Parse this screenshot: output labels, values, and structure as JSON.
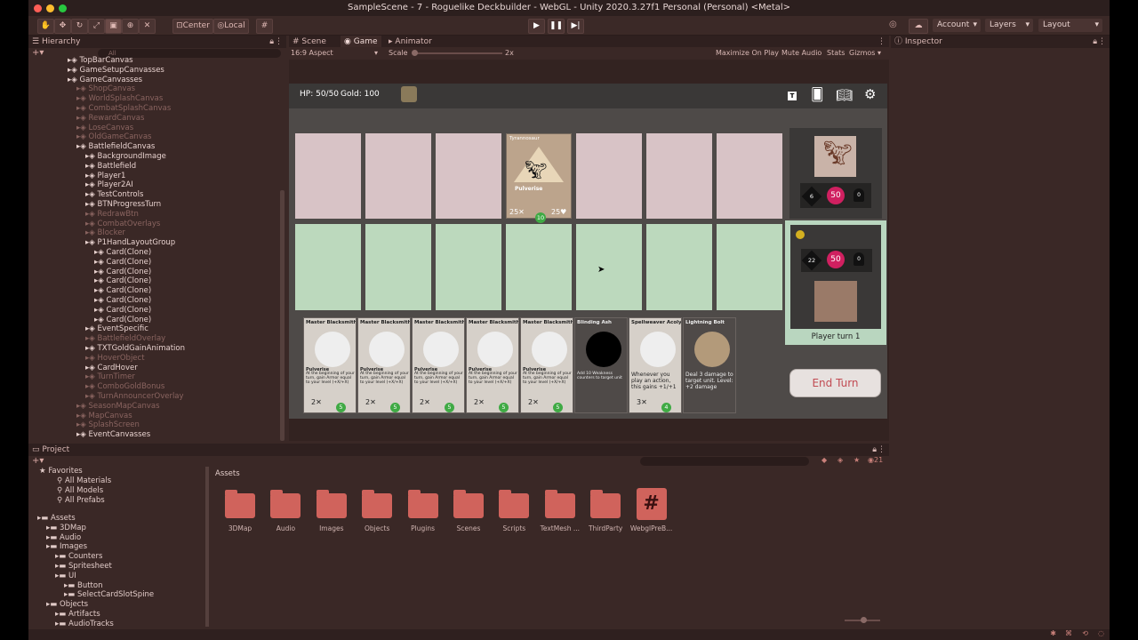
{
  "window": {
    "title": "SampleScene - 7 - Roguelike Deckbuilder - WebGL - Unity 2020.3.27f1 Personal (Personal) <Metal>"
  },
  "toolbar": {
    "pivot_label": "Center",
    "space_label": "Local",
    "account_label": "Account",
    "layers_label": "Layers",
    "layout_label": "Layout"
  },
  "hierarchy": {
    "tab": "Hierarchy",
    "search_placeholder": "All",
    "items": [
      {
        "label": "TopBarCanvas",
        "indent": 0,
        "dim": false
      },
      {
        "label": "GameSetupCanvasses",
        "indent": 0,
        "dim": false
      },
      {
        "label": "GameCanvasses",
        "indent": 0,
        "dim": false
      },
      {
        "label": "ShopCanvas",
        "indent": 1,
        "dim": true
      },
      {
        "label": "WorldSplashCanvas",
        "indent": 1,
        "dim": true
      },
      {
        "label": "CombatSplashCanvas",
        "indent": 1,
        "dim": true
      },
      {
        "label": "RewardCanvas",
        "indent": 1,
        "dim": true
      },
      {
        "label": "LoseCanvas",
        "indent": 1,
        "dim": true
      },
      {
        "label": "OldGameCanvas",
        "indent": 1,
        "dim": true
      },
      {
        "label": "BattlefieldCanvas",
        "indent": 1,
        "dim": false
      },
      {
        "label": "BackgroundImage",
        "indent": 2,
        "dim": false
      },
      {
        "label": "Battlefield",
        "indent": 2,
        "dim": false
      },
      {
        "label": "Player1",
        "indent": 2,
        "dim": false
      },
      {
        "label": "Player2AI",
        "indent": 2,
        "dim": false
      },
      {
        "label": "TestControls",
        "indent": 2,
        "dim": false
      },
      {
        "label": "BTNProgressTurn",
        "indent": 2,
        "dim": false
      },
      {
        "label": "RedrawBtn",
        "indent": 2,
        "dim": true
      },
      {
        "label": "CombatOverlays",
        "indent": 2,
        "dim": true
      },
      {
        "label": "Blocker",
        "indent": 2,
        "dim": true
      },
      {
        "label": "P1HandLayoutGroup",
        "indent": 2,
        "dim": false
      },
      {
        "label": "Card(Clone)",
        "indent": 3,
        "dim": false
      },
      {
        "label": "Card(Clone)",
        "indent": 3,
        "dim": false
      },
      {
        "label": "Card(Clone)",
        "indent": 3,
        "dim": false
      },
      {
        "label": "Card(Clone)",
        "indent": 3,
        "dim": false
      },
      {
        "label": "Card(Clone)",
        "indent": 3,
        "dim": false
      },
      {
        "label": "Card(Clone)",
        "indent": 3,
        "dim": false
      },
      {
        "label": "Card(Clone)",
        "indent": 3,
        "dim": false
      },
      {
        "label": "Card(Clone)",
        "indent": 3,
        "dim": false
      },
      {
        "label": "EventSpecific",
        "indent": 2,
        "dim": false
      },
      {
        "label": "BattlefieldOverlay",
        "indent": 2,
        "dim": true
      },
      {
        "label": "TXTGoldGainAnimation",
        "indent": 2,
        "dim": false
      },
      {
        "label": "HoverObject",
        "indent": 2,
        "dim": true
      },
      {
        "label": "CardHover",
        "indent": 2,
        "dim": false
      },
      {
        "label": "TurnTimer",
        "indent": 2,
        "dim": true
      },
      {
        "label": "ComboGoldBonus",
        "indent": 2,
        "dim": true
      },
      {
        "label": "TurnAnnouncerOverlay",
        "indent": 2,
        "dim": true
      },
      {
        "label": "SeasonMapCanvas",
        "indent": 1,
        "dim": true
      },
      {
        "label": "MapCanvas",
        "indent": 1,
        "dim": true
      },
      {
        "label": "SplashScreen",
        "indent": 1,
        "dim": true
      },
      {
        "label": "EventCanvasses",
        "indent": 1,
        "dim": false
      }
    ]
  },
  "view_tabs": {
    "scene": "Scene",
    "game": "Game",
    "animator": "Animator"
  },
  "game_toolbar": {
    "aspect": "16:9 Aspect",
    "scale_label": "Scale",
    "scale_value": "2x",
    "maximize": "Maximize On Play",
    "mute": "Mute Audio",
    "stats": "Stats",
    "gizmos": "Gizmos"
  },
  "game": {
    "hp": "HP: 50/50",
    "gold": "Gold: 100",
    "topright_letter": "T",
    "board_card": {
      "name": "Tyrannosaur",
      "ability": "Pulverise",
      "attack": "25✕",
      "health": "25♥",
      "cost": "10"
    },
    "enemy_panel": {
      "attack": "6",
      "health": "50",
      "armor": "0"
    },
    "player_panel": {
      "attack": "22",
      "health": "50",
      "armor": "0",
      "label": "Player turn 1"
    },
    "end_turn": "End Turn",
    "hand": [
      {
        "name": "Master Blacksmith",
        "ability": "Pulverise",
        "desc": "At the beginning of your turn, gain Armor equal to your level (+X/+X)",
        "cost": "2✕",
        "gem": "5"
      },
      {
        "name": "Master Blacksmith",
        "ability": "Pulverise",
        "desc": "At the beginning of your turn, gain Armor equal to your level (+X/+X)",
        "cost": "2✕",
        "gem": "5"
      },
      {
        "name": "Master Blacksmith",
        "ability": "Pulverise",
        "desc": "At the beginning of your turn, gain Armor equal to your level (+X/+X)",
        "cost": "2✕",
        "gem": "5"
      },
      {
        "name": "Master Blacksmith",
        "ability": "Pulverise",
        "desc": "At the beginning of your turn, gain Armor equal to your level (+X/+X)",
        "cost": "2✕",
        "gem": "5"
      },
      {
        "name": "Master Blacksmith",
        "ability": "Pulverise",
        "desc": "At the beginning of your turn, gain Armor equal to your level (+X/+X)",
        "cost": "2✕",
        "gem": "5"
      },
      {
        "name": "Blinding Ash",
        "ability": "",
        "desc": "Add 10 Weakness counters to target unit",
        "cost": "",
        "gem": ""
      },
      {
        "name": "Spellweaver Acolyte",
        "ability": "",
        "desc": "Whenever you play an action, this gains +1/+1",
        "cost": "3✕",
        "gem": "4"
      },
      {
        "name": "Lightning Bolt",
        "ability": "",
        "desc": "Deal 3 damage to target unit. Level: +2 damage",
        "cost": "",
        "gem": ""
      }
    ]
  },
  "inspector": {
    "tab": "Inspector"
  },
  "project": {
    "tab": "Project",
    "favorites": [
      "Favorites",
      "All Materials",
      "All Models",
      "All Prefabs"
    ],
    "tree": [
      {
        "label": "Assets",
        "indent": 0
      },
      {
        "label": "3DMap",
        "indent": 1
      },
      {
        "label": "Audio",
        "indent": 1
      },
      {
        "label": "Images",
        "indent": 1
      },
      {
        "label": "Counters",
        "indent": 2
      },
      {
        "label": "Spritesheet",
        "indent": 2
      },
      {
        "label": "UI",
        "indent": 2
      },
      {
        "label": "Button",
        "indent": 3
      },
      {
        "label": "SelectCardSlotSpine",
        "indent": 3
      },
      {
        "label": "Objects",
        "indent": 1
      },
      {
        "label": "Artifacts",
        "indent": 2
      },
      {
        "label": "AudioTracks",
        "indent": 2
      }
    ],
    "breadcrumb": "Assets",
    "folders": [
      "3DMap",
      "Audio",
      "Images",
      "Objects",
      "Plugins",
      "Scenes",
      "Scripts",
      "TextMesh ...",
      "ThirdParty",
      "WebglPreB..."
    ],
    "count": "21"
  },
  "colors": {
    "accent": "#d0635c",
    "player_panel": "#b9d6bf",
    "enemy_slots": "#d8c3c6",
    "player_slots": "#bcd9bd"
  }
}
